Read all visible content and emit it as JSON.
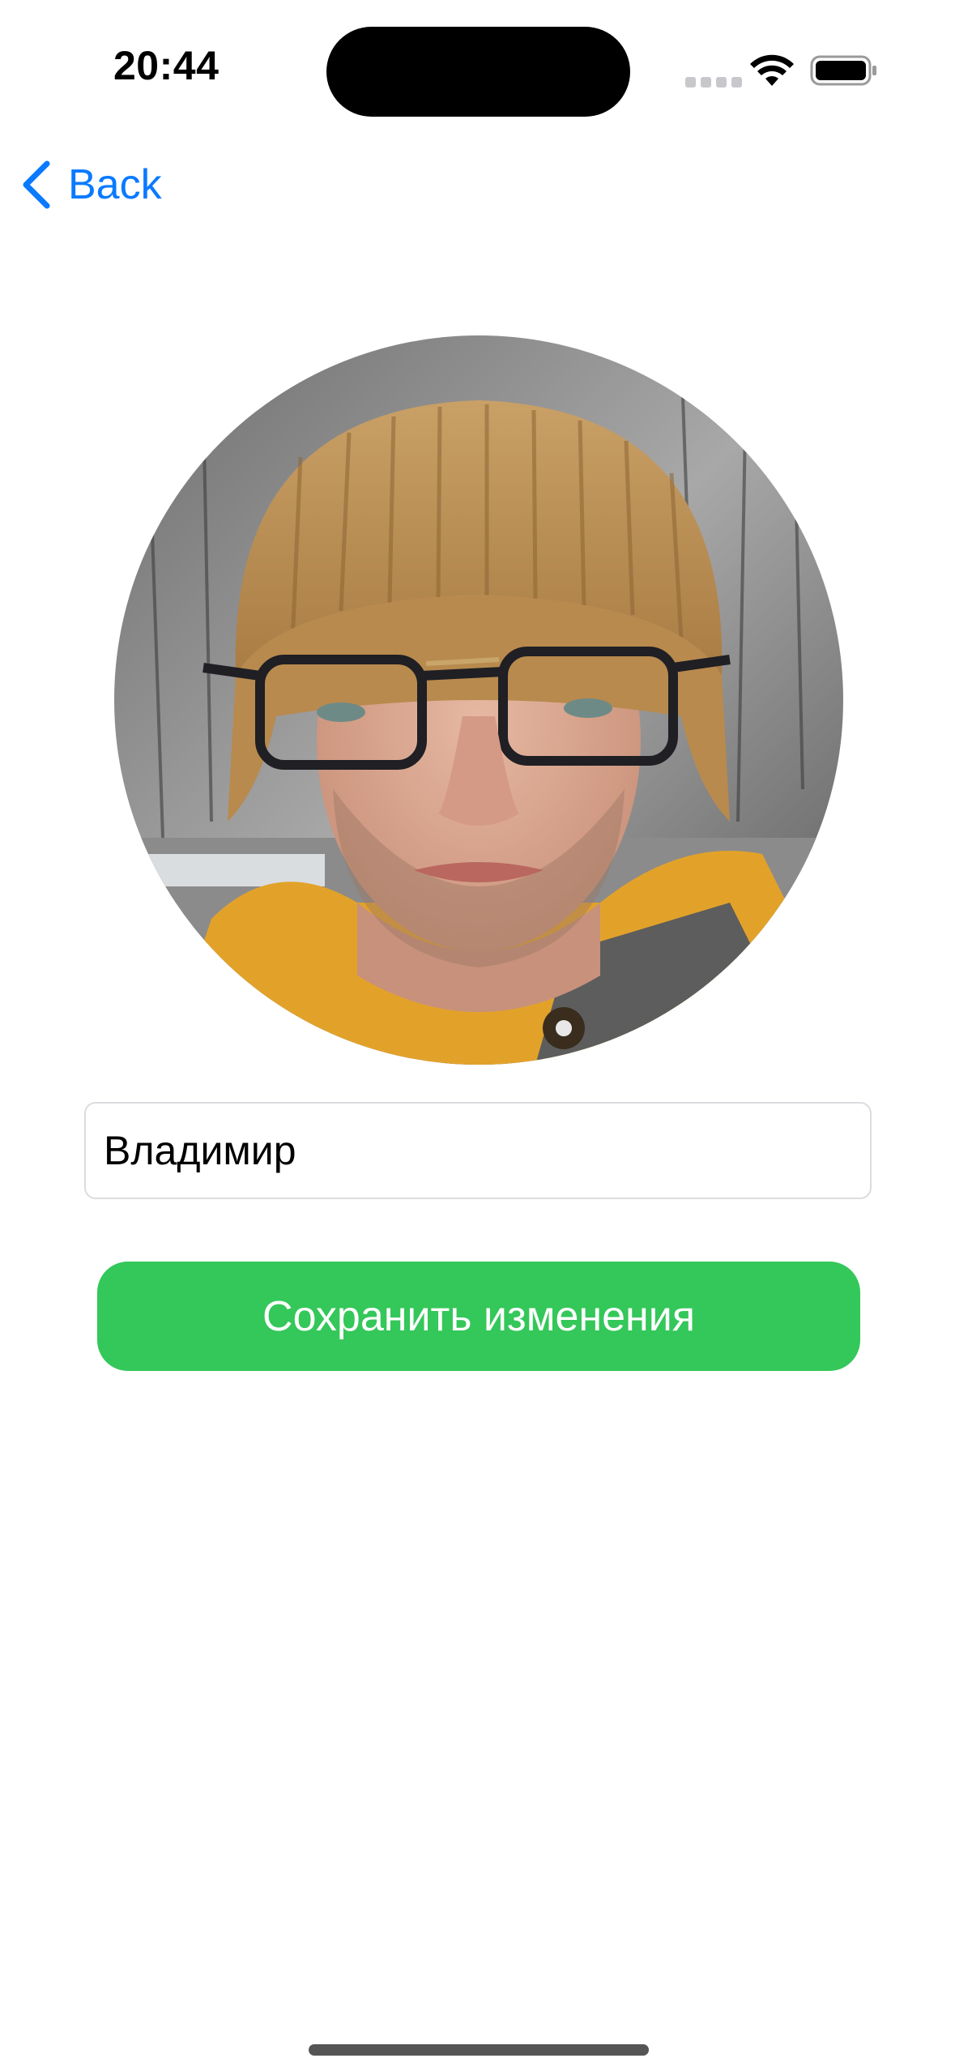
{
  "status_bar": {
    "time": "20:44"
  },
  "nav": {
    "back_label": "Back",
    "back_icon": "chevron-left-icon"
  },
  "profile": {
    "name_value": "Владимир",
    "avatar_description": "avatar-photo"
  },
  "actions": {
    "save_label": "Сохранить изменения"
  },
  "colors": {
    "accent_blue": "#0a7aff",
    "save_green": "#34c759",
    "field_border": "#dcdce0"
  }
}
